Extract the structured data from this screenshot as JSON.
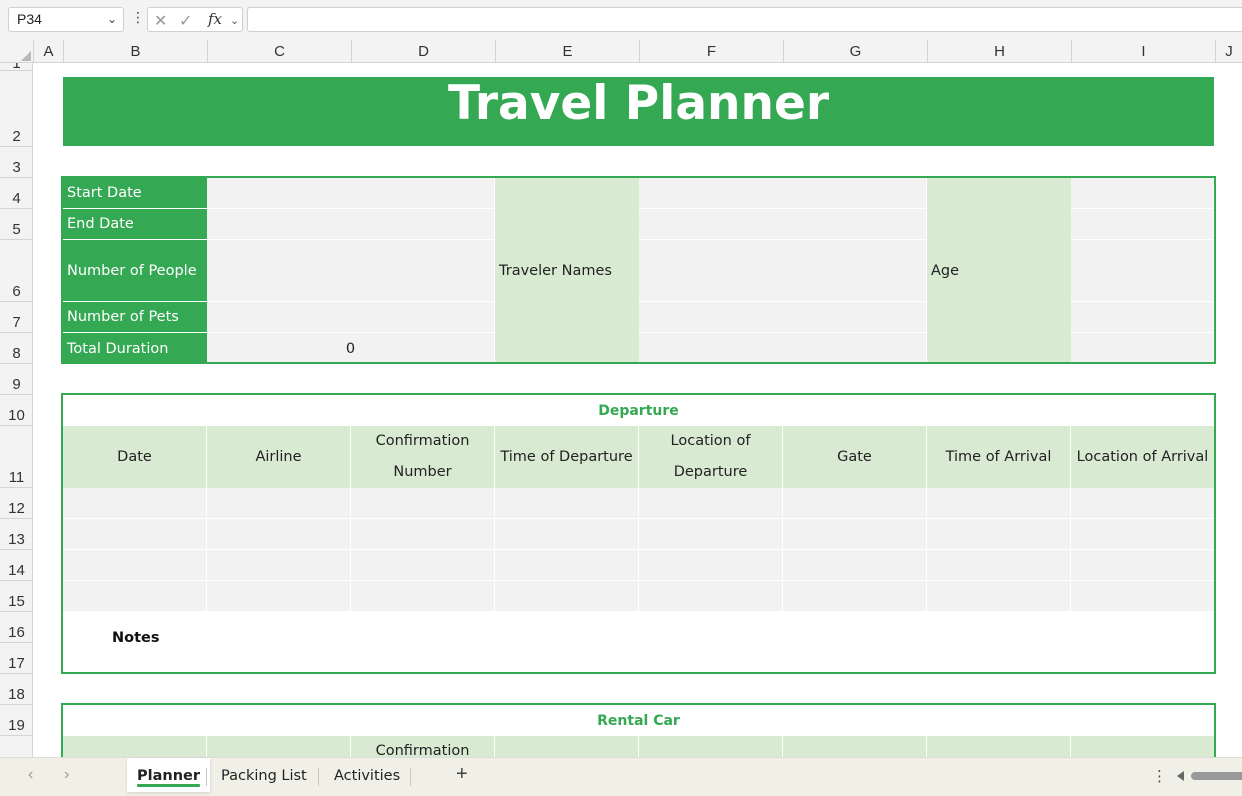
{
  "formula_bar": {
    "name_box": "P34",
    "formula": ""
  },
  "columns": [
    "A",
    "B",
    "C",
    "D",
    "E",
    "F",
    "G",
    "H",
    "I",
    "J"
  ],
  "rows": [
    "1",
    "2",
    "3",
    "4",
    "5",
    "6",
    "7",
    "8",
    "9",
    "10",
    "11",
    "12",
    "13",
    "14",
    "15",
    "16",
    "17",
    "18",
    "19"
  ],
  "title": "Travel Planner",
  "trip_info": {
    "start_date": "Start Date",
    "end_date": "End Date",
    "people": "Number of People",
    "pets": "Number of Pets",
    "duration": "Total Duration",
    "duration_value": "0",
    "traveler_names": "Traveler Names",
    "age": "Age"
  },
  "departure": {
    "title": "Departure",
    "headers": [
      "Date",
      "Airline",
      "Confirmation Number",
      "Time of Departure",
      "Location of Departure",
      "Gate",
      "Time of Arrival",
      "Location of Arrival"
    ],
    "notes": "Notes"
  },
  "rental_car": {
    "title": "Rental Car",
    "headers": [
      "",
      "",
      "Confirmation",
      "",
      "",
      "",
      "",
      ""
    ]
  },
  "sheet_tabs": [
    {
      "label": "Planner",
      "active": true
    },
    {
      "label": "Packing List",
      "active": false
    },
    {
      "label": "Activities",
      "active": false
    }
  ],
  "colors": {
    "accent_green": "#34a853",
    "light_green": "#d9ead3",
    "input_gray": "#f2f2f2"
  }
}
